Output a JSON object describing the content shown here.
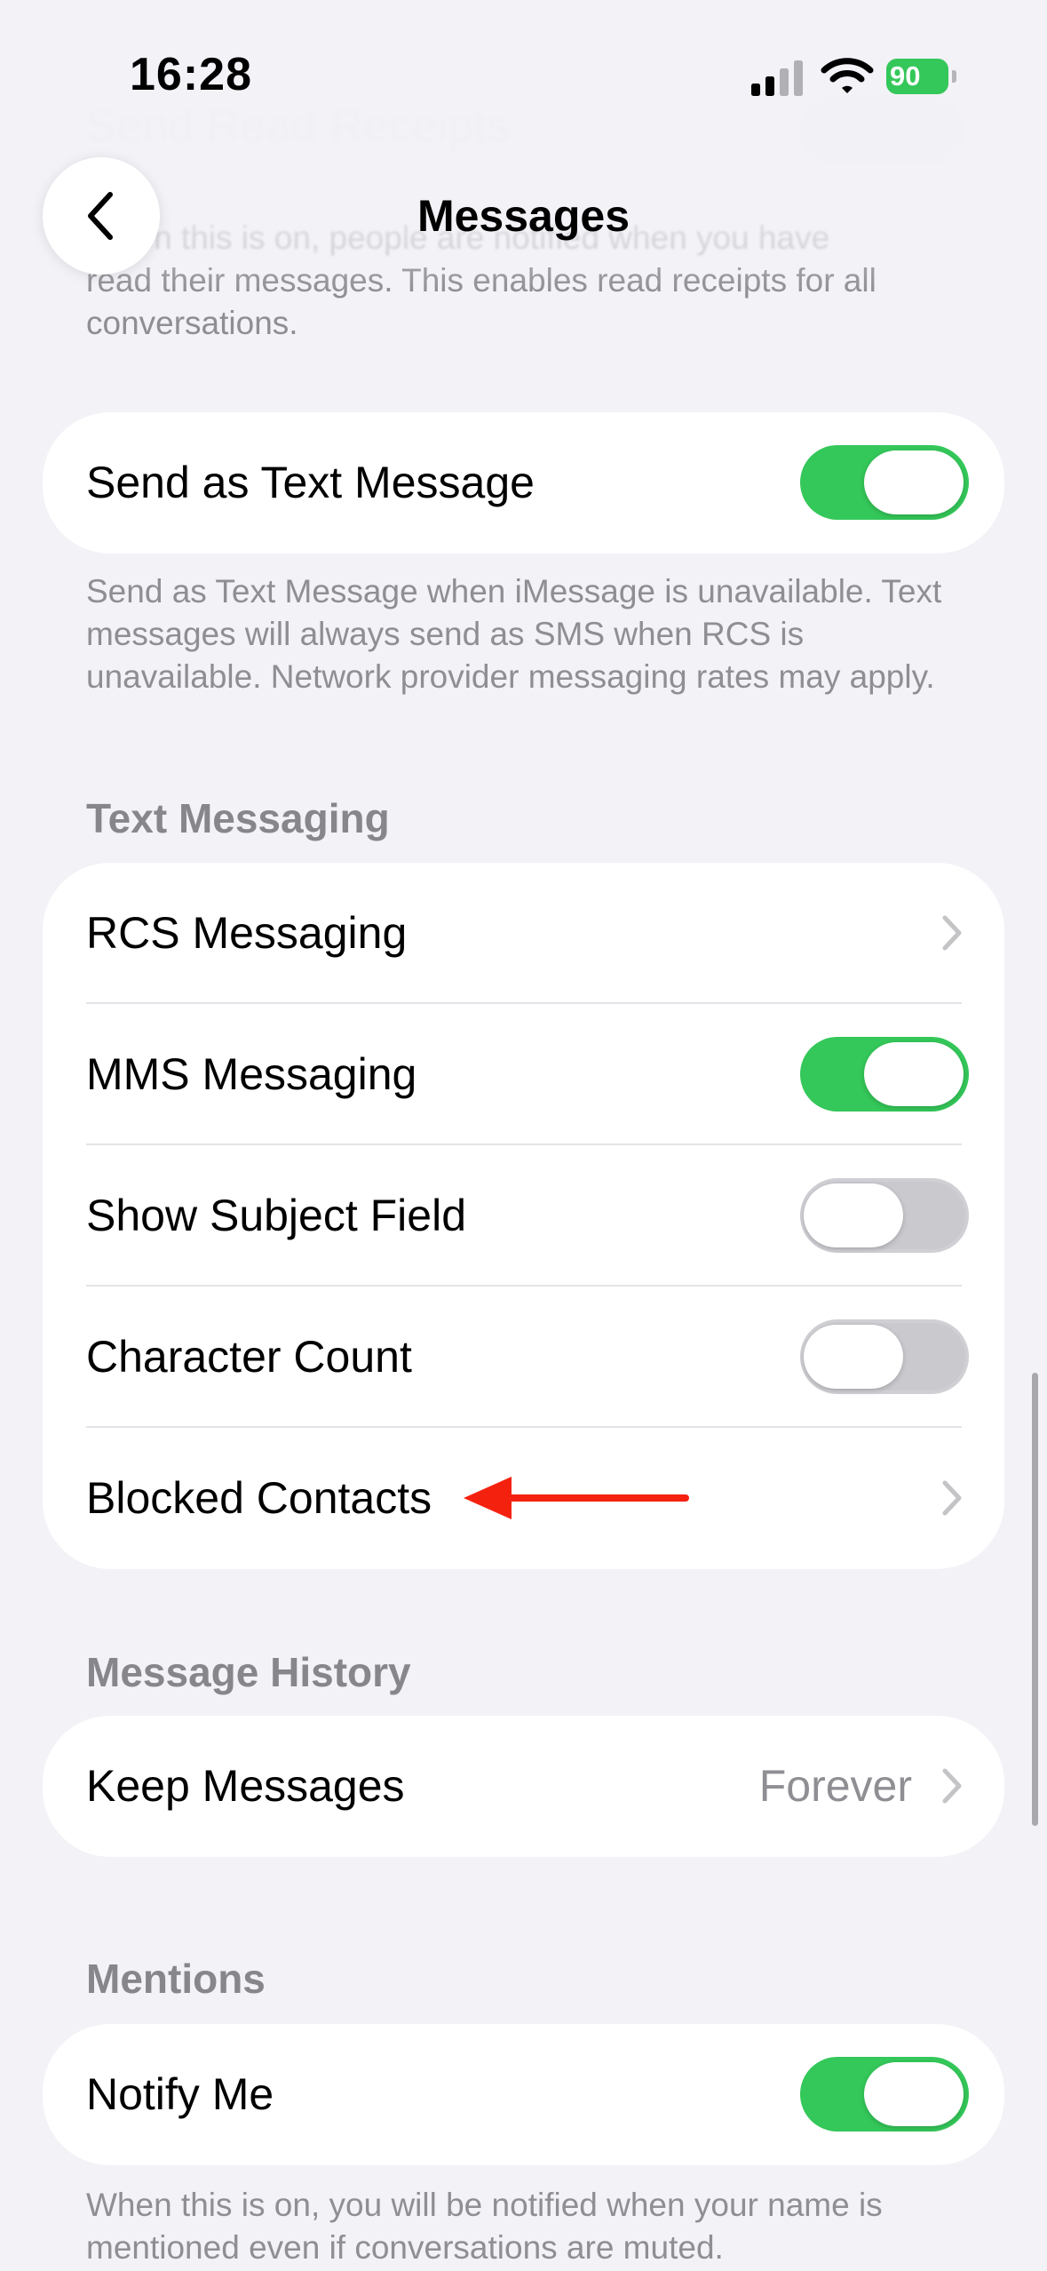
{
  "status_bar": {
    "time": "16:28",
    "battery": "90"
  },
  "nav": {
    "title": "Messages"
  },
  "read_receipts": {
    "label": "Send Read Receipts",
    "footer_line1": "When this is on, people are notified when you have",
    "footer_line2": "read their messages. This enables read receipts for all",
    "footer_line3": "conversations."
  },
  "send_as_text": {
    "label": "Send as Text Message",
    "on": true,
    "footer": "Send as Text Message when iMessage is unavailable. Text messages will always send as SMS when RCS is unavailable. Network provider messaging rates may apply."
  },
  "text_messaging": {
    "header": "Text Messaging",
    "rows": [
      {
        "label": "RCS Messaging",
        "type": "link"
      },
      {
        "label": "MMS Messaging",
        "type": "toggle",
        "on": true
      },
      {
        "label": "Show Subject Field",
        "type": "toggle",
        "on": false
      },
      {
        "label": "Character Count",
        "type": "toggle",
        "on": false
      },
      {
        "label": "Blocked Contacts",
        "type": "link"
      }
    ]
  },
  "message_history": {
    "header": "Message History",
    "keep_messages": {
      "label": "Keep Messages",
      "value": "Forever"
    }
  },
  "mentions": {
    "header": "Mentions",
    "notify_me": {
      "label": "Notify Me",
      "on": true
    },
    "footer": "When this is on, you will be notified when your name is mentioned even if conversations are muted."
  },
  "colors": {
    "accent_green": "#34c759",
    "annotation_red": "#f5210f",
    "background": "#f2f2f7"
  },
  "icons": [
    "back-chevron-icon",
    "cellular-signal-icon",
    "wifi-icon",
    "battery-icon",
    "chevron-right-icon"
  ]
}
